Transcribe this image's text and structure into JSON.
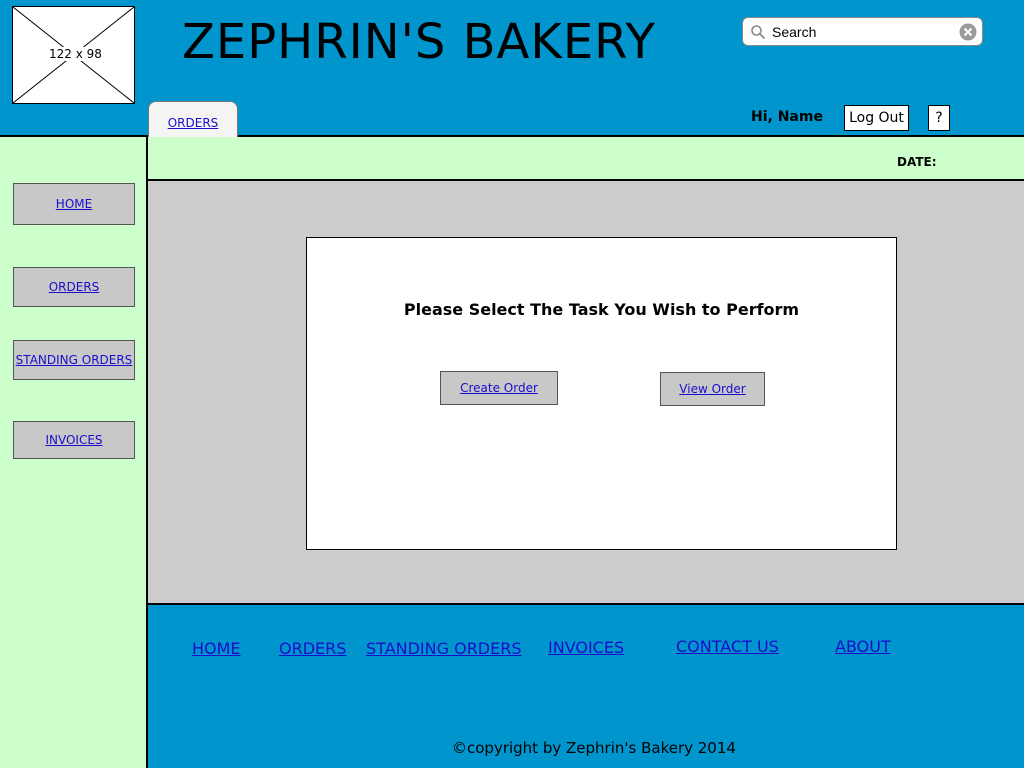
{
  "header": {
    "logo_placeholder": "122 x 98",
    "title": "ZEPHRIN'S BAKERY",
    "search": {
      "placeholder": "Search",
      "value": ""
    },
    "tab_orders": "ORDERS",
    "greeting": "Hi, Name",
    "logout_label": "Log Out",
    "help_label": "?"
  },
  "sidebar": {
    "items": [
      {
        "label": "HOME"
      },
      {
        "label": "ORDERS"
      },
      {
        "label": "STANDING ORDERS"
      },
      {
        "label": "INVOICES"
      }
    ]
  },
  "datebar": {
    "date_label": "DATE:"
  },
  "main": {
    "prompt": "Please Select The Task You Wish to Perform",
    "create_label": "Create Order",
    "view_label": "View Order"
  },
  "footer": {
    "links": [
      {
        "label": "HOME"
      },
      {
        "label": "ORDERS"
      },
      {
        "label": "STANDING ORDERS"
      },
      {
        "label": "INVOICES"
      },
      {
        "label": "CONTACT US"
      },
      {
        "label": "ABOUT"
      }
    ],
    "copyright": "©copyright by Zephrin's Bakery 2014"
  },
  "colors": {
    "header_blue": "#0095cc",
    "sidebar_green": "#ccffcc",
    "content_gray": "#cccccc",
    "link_blue": "#1a0dcc"
  }
}
